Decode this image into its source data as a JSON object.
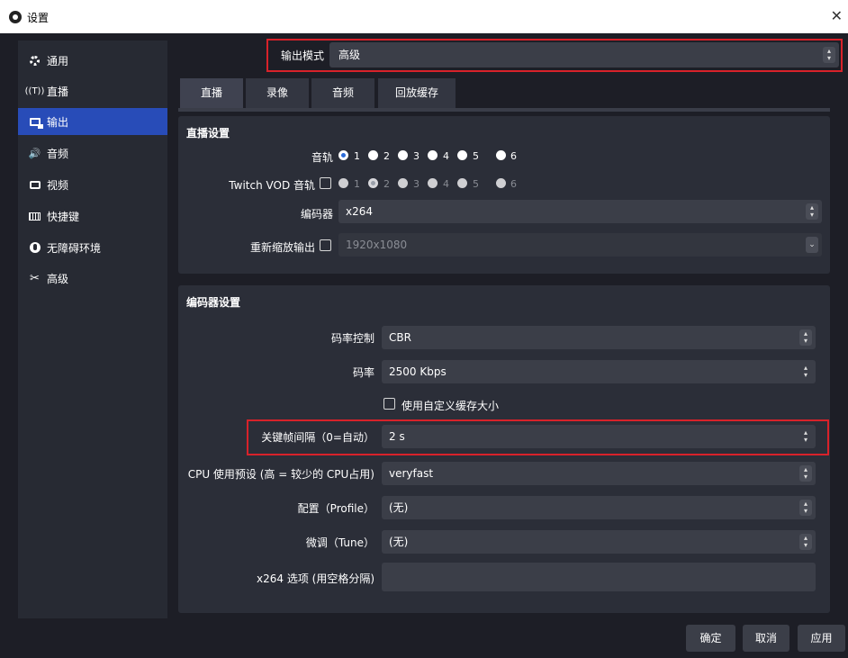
{
  "window": {
    "title": "设置",
    "close_glyph": "✕"
  },
  "sidebar": {
    "items": [
      {
        "label": "通用",
        "icon": "gear-icon"
      },
      {
        "label": "直播",
        "icon": "antenna-icon"
      },
      {
        "label": "输出",
        "icon": "output-icon",
        "active": true
      },
      {
        "label": "音频",
        "icon": "speaker-icon"
      },
      {
        "label": "视频",
        "icon": "monitor-icon"
      },
      {
        "label": "快捷键",
        "icon": "keyboard-icon"
      },
      {
        "label": "无障碍环境",
        "icon": "accessibility-icon"
      },
      {
        "label": "高级",
        "icon": "tools-icon"
      }
    ]
  },
  "output_mode": {
    "label": "输出模式",
    "value": "高级"
  },
  "tabs": [
    {
      "label": "直播",
      "active": true
    },
    {
      "label": "录像"
    },
    {
      "label": "音频"
    },
    {
      "label": "回放缓存"
    }
  ],
  "stream_settings": {
    "title": "直播设置",
    "audio_track_label": "音轨",
    "audio_tracks": [
      "1",
      "2",
      "3",
      "4",
      "5",
      "6"
    ],
    "audio_track_selected": "1",
    "twitch_vod_label": "Twitch VOD 音轨",
    "twitch_vod_enabled": false,
    "twitch_tracks": [
      "1",
      "2",
      "3",
      "4",
      "5",
      "6"
    ],
    "twitch_track_selected": "2",
    "encoder_label": "编码器",
    "encoder_value": "x264",
    "rescale_label": "重新缩放输出",
    "rescale_enabled": false,
    "rescale_value": "1920x1080"
  },
  "encoder_settings": {
    "title": "编码器设置",
    "rate_control_label": "码率控制",
    "rate_control_value": "CBR",
    "bitrate_label": "码率",
    "bitrate_value": "2500 Kbps",
    "custom_buffer_label": "使用自定义缓存大小",
    "custom_buffer_enabled": false,
    "keyframe_label": "关键帧间隔（0=自动）",
    "keyframe_value": "2 s",
    "cpu_preset_label": "CPU 使用预设 (高 = 较少的 CPU占用)",
    "cpu_preset_value": "veryfast",
    "profile_label": "配置（Profile）",
    "profile_value": "(无)",
    "tune_label": "微调（Tune）",
    "tune_value": "(无)",
    "x264_options_label": "x264 选项 (用空格分隔)",
    "x264_options_value": ""
  },
  "buttons": {
    "ok": "确定",
    "cancel": "取消",
    "apply": "应用"
  },
  "colors": {
    "accent": "#284cb8",
    "highlight_box": "#d8222a",
    "radio_selected": "#2b6bd8"
  }
}
